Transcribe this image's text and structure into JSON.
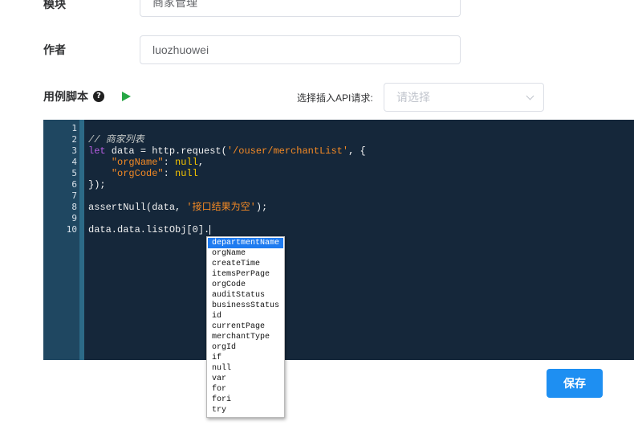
{
  "form": {
    "module_label": "模块",
    "module_value": "商家管理",
    "author_label": "作者",
    "author_value": "luozhuowei",
    "script_label": "用例脚本",
    "help_icon": "question-circle-icon",
    "run_icon": "play-icon",
    "api_label": "选择插入API请求:",
    "api_placeholder": "请选择"
  },
  "editor": {
    "line_numbers": [
      "1",
      "2",
      "3",
      "4",
      "5",
      "6",
      "7",
      "8",
      "9",
      "10"
    ],
    "code": {
      "l2_comment": "// 商家列表",
      "l3_kw": "let",
      "l3_a": " data = http.request(",
      "l3_str": "'/ouser/merchantList'",
      "l3_b": ", {",
      "l4_indent": "    ",
      "l4_key": "\"orgName\"",
      "l4_colon": ": ",
      "l4_val": "null",
      "l4_end": ",",
      "l5_indent": "    ",
      "l5_key": "\"orgCode\"",
      "l5_colon": ": ",
      "l5_val": "null",
      "l6": "});",
      "l8_a": "assertNull(data, ",
      "l8_str": "'接口结果为空'",
      "l8_b": ");",
      "l10": "data.data.listObj[0]."
    }
  },
  "autocomplete": {
    "items": [
      "departmentName",
      "orgName",
      "createTime",
      "itemsPerPage",
      "orgCode",
      "auditStatus",
      "businessStatus",
      "id",
      "currentPage",
      "merchantType",
      "orgId",
      "if",
      "null",
      "var",
      "for",
      "fori",
      "try"
    ]
  },
  "actions": {
    "save_label": "保存"
  },
  "colors": {
    "editor_bg": "#15273a",
    "gutter_bg": "#1f4761",
    "primary": "#1e8ff2",
    "string": "#f58a24",
    "keyword": "#b55ce0",
    "null": "#f5c400",
    "run_green": "#27a745"
  }
}
